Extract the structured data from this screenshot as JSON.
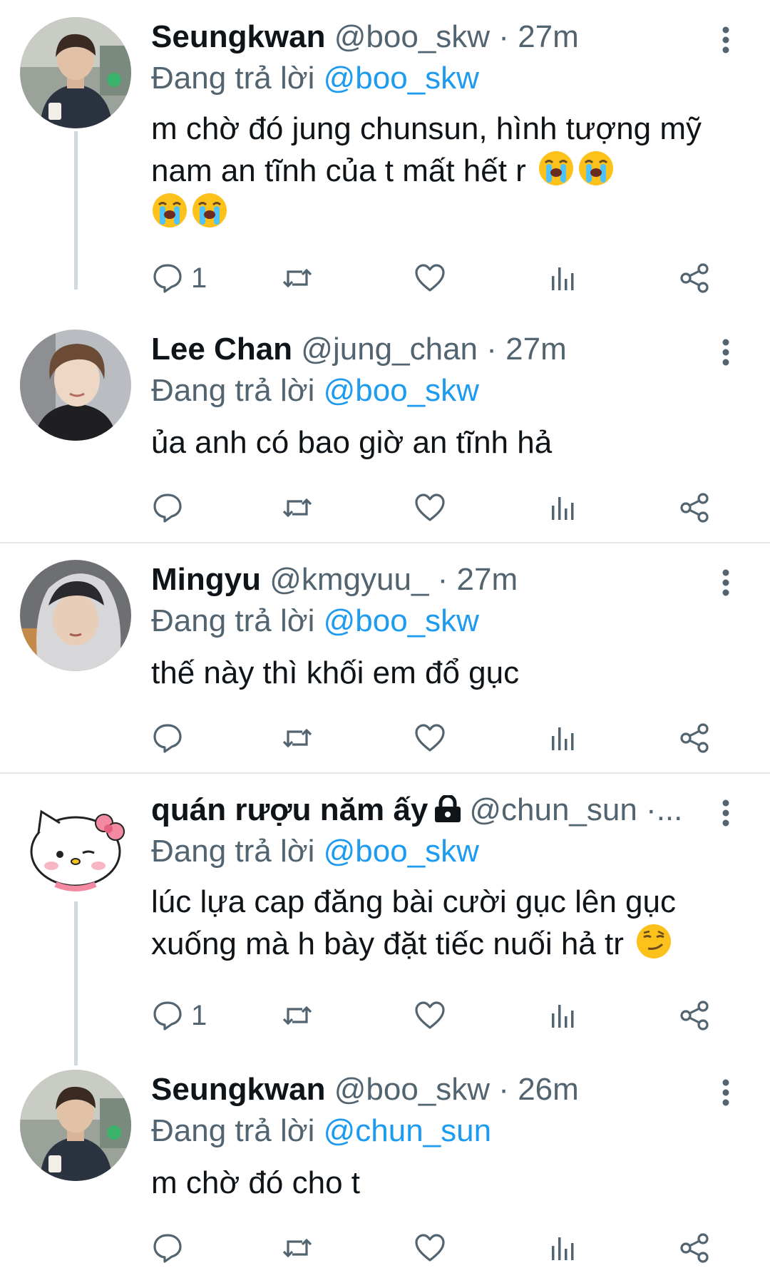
{
  "reply_prefix": "Đang trả lời",
  "tweets": [
    {
      "name": "Seungkwan",
      "handle": "@boo_skw",
      "separator": "·",
      "time": "27m",
      "reply_to": "@boo_skw",
      "text": "m chờ đó jung chunsun, hình tượng mỹ nam an tĩnh của t mất hết r",
      "emojis": [
        "loudly-crying-face",
        "loudly-crying-face",
        "loudly-crying-face",
        "loudly-crying-face"
      ],
      "reply_count": "1",
      "avatar": "seungkwan-avatar"
    },
    {
      "name": "Lee Chan",
      "handle": "@jung_chan",
      "separator": "·",
      "time": "27m",
      "reply_to": "@boo_skw",
      "text": "ủa anh có bao giờ an tĩnh hả",
      "reply_count": "",
      "avatar": "lee-chan-avatar"
    },
    {
      "name": "Mingyu",
      "handle": "@kmgyuu_",
      "separator": "·",
      "time": "27m",
      "reply_to": "@boo_skw",
      "text": "thế này thì khối em đổ gục",
      "reply_count": "",
      "avatar": "mingyu-avatar"
    },
    {
      "name": "quán rượu năm ấy",
      "handle": "@chun_sun ·...",
      "reply_to": "@boo_skw",
      "text": "lúc lựa cap đăng bài cười gục lên gục xuống mà h bày đặt tiếc nuối hả tr",
      "emojis": [
        "smirking-face"
      ],
      "reply_count": "1",
      "avatar": "hello-kitty-avatar",
      "protected_icon": "lock-icon"
    },
    {
      "name": "Seungkwan",
      "handle": "@boo_skw",
      "separator": "·",
      "time": "26m",
      "reply_to": "@chun_sun",
      "text": "m chờ đó cho t",
      "reply_count": "",
      "avatar": "seungkwan-avatar"
    }
  ],
  "colors": {
    "accent": "#1d9bf0",
    "secondary_text": "#536471",
    "thread_line": "#cfd9de",
    "divider": "#e6e9ec"
  },
  "icons": [
    "reply-icon",
    "retweet-icon",
    "like-icon",
    "views-icon",
    "share-icon",
    "more-icon"
  ]
}
